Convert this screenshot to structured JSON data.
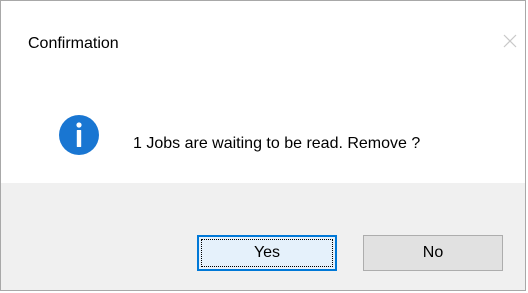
{
  "window": {
    "title": "Confirmation"
  },
  "message": {
    "text": "1 Jobs are waiting to be read. Remove ?",
    "icon": "info-icon"
  },
  "buttons": {
    "yes_label": "Yes",
    "no_label": "No"
  },
  "colors": {
    "icon_blue": "#1976d2",
    "focus_border": "#0078d7",
    "footer_bg": "#f0f0f0"
  }
}
